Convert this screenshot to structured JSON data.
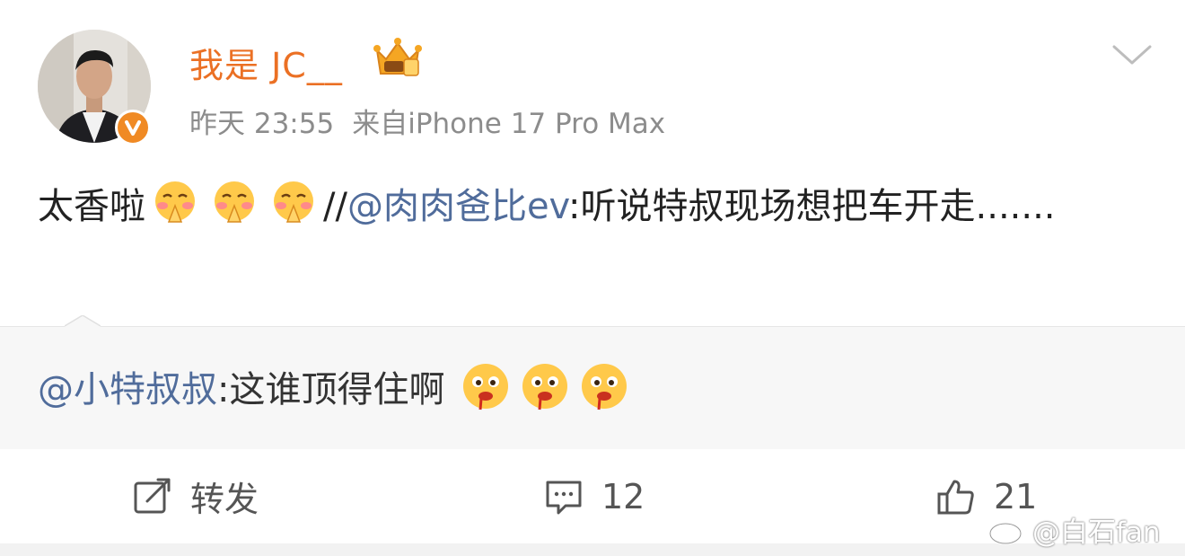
{
  "post": {
    "username": "我是 JC__",
    "time": "昨天 23:55",
    "source": "来自iPhone 17 Pro Max",
    "text_prefix": "太香啦",
    "repost_sep": "//",
    "mention": "@肉肉爸比ev",
    "text_suffix": ":听说特叔现场想把车开走.......",
    "emoji_name": "pray-blush-emoji"
  },
  "repost": {
    "mention": "@小特叔叔",
    "text": ":这谁顶得住啊",
    "emoji_name": "drooling-emoji"
  },
  "actions": {
    "forward_label": "转发",
    "comment_count": "12",
    "like_count": "21"
  },
  "watermark": "@白石fan",
  "colors": {
    "username": "#eb7024",
    "mention": "#506c9b",
    "meta": "#8c8c8c",
    "badge": "#f08a24"
  }
}
